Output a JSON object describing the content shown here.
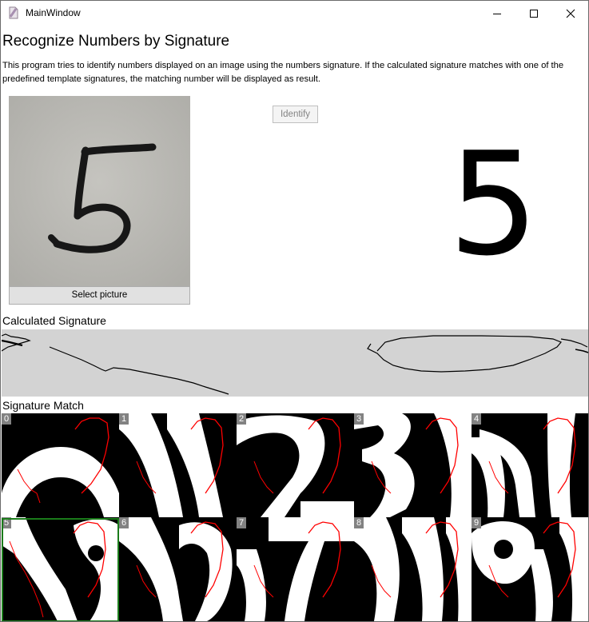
{
  "window": {
    "title": "MainWindow",
    "controls": {
      "minimize": "minimize-icon",
      "maximize": "maximize-icon",
      "close": "close-icon"
    }
  },
  "header": {
    "title": "Recognize Numbers by Signature",
    "description": "This program tries to identify numbers displayed on an image using the numbers signature. If the calculated signature matches with one of the predefined template signatures, the matching number will be displayed as result."
  },
  "input": {
    "photo_digit": "5",
    "select_label": "Select picture",
    "identify_label": "Identify",
    "identify_enabled": false
  },
  "result": {
    "value": "5"
  },
  "signature": {
    "label": "Calculated Signature"
  },
  "match": {
    "label": "Signature Match",
    "templates": [
      {
        "label": "0"
      },
      {
        "label": "1"
      },
      {
        "label": "2"
      },
      {
        "label": "3"
      },
      {
        "label": "4"
      },
      {
        "label": "5"
      },
      {
        "label": "6"
      },
      {
        "label": "7"
      },
      {
        "label": "8"
      },
      {
        "label": "9"
      }
    ],
    "selected": "5"
  },
  "colors": {
    "window_border": "#6b6b6b",
    "signature_background": "#d3d3d3",
    "match_highlight": "#1a7b1a",
    "signature_curve": "#ff0000",
    "badge_background": "#828282"
  }
}
